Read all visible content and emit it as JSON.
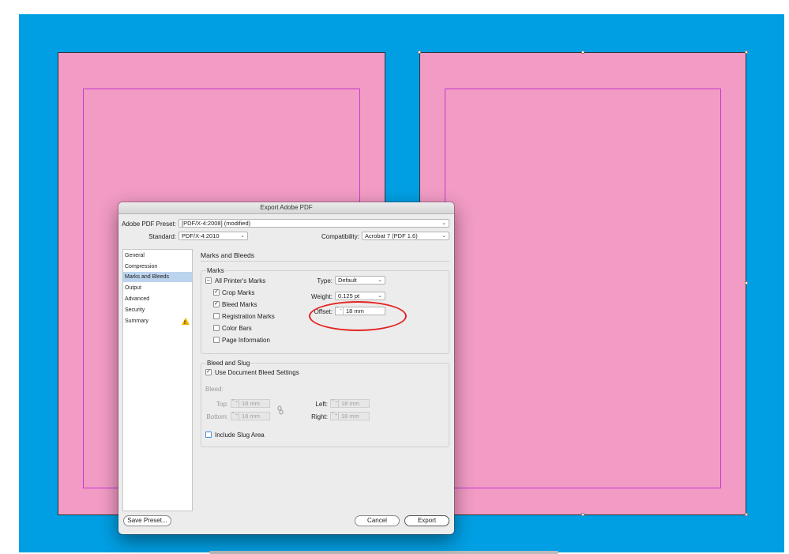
{
  "dialog": {
    "title": "Export Adobe PDF",
    "preset_label": "Adobe PDF Preset:",
    "preset_value": "[PDF/X-4:2008] (modified)",
    "standard_label": "Standard:",
    "standard_value": "PDF/X-4:2010",
    "compat_label": "Compatibility:",
    "compat_value": "Acrobat 7 (PDF 1.6)",
    "sidebar": [
      {
        "label": "General"
      },
      {
        "label": "Compression"
      },
      {
        "label": "Marks and Bleeds",
        "selected": true
      },
      {
        "label": "Output"
      },
      {
        "label": "Advanced"
      },
      {
        "label": "Security"
      },
      {
        "label": "Summary",
        "warning": true
      }
    ],
    "section_title": "Marks and Bleeds",
    "marks": {
      "group_label": "Marks",
      "all_printers": {
        "label": "All Printer's Marks",
        "state": "mixed"
      },
      "crop": {
        "label": "Crop Marks",
        "checked": true
      },
      "bleed": {
        "label": "Bleed Marks",
        "checked": true
      },
      "registration": {
        "label": "Registration Marks",
        "checked": false
      },
      "color_bars": {
        "label": "Color Bars",
        "checked": false
      },
      "page_info": {
        "label": "Page Information",
        "checked": false
      },
      "type_label": "Type:",
      "type_value": "Default",
      "weight_label": "Weight:",
      "weight_value": "0.125 pt",
      "offset_label": "Offset:",
      "offset_value": "18 mm"
    },
    "bleed": {
      "group_label": "Bleed and Slug",
      "use_doc": {
        "label": "Use Document Bleed Settings",
        "checked": true
      },
      "bleed_label": "Bleed:",
      "top_label": "Top:",
      "top_value": "18 mm",
      "bottom_label": "Bottom:",
      "bottom_value": "18 mm",
      "left_label": "Left:",
      "left_value": "18 mm",
      "right_label": "Right:",
      "right_value": "18 mm",
      "slug": {
        "label": "Include Slug Area",
        "checked": false
      }
    },
    "buttons": {
      "save_preset": "Save Preset...",
      "cancel": "Cancel",
      "export": "Export"
    },
    "check_glyph": "✓",
    "mixed_glyph": "–",
    "chevron": "⌄",
    "spin_glyph": "⌃⌄",
    "warn_glyph": "!"
  },
  "colors": {
    "pasteboard": "#009fe3",
    "page": "#f29bc4",
    "margin_guide": "#c43bd6",
    "annotation": "#e52421",
    "selected_item": "#bcd3ee"
  }
}
